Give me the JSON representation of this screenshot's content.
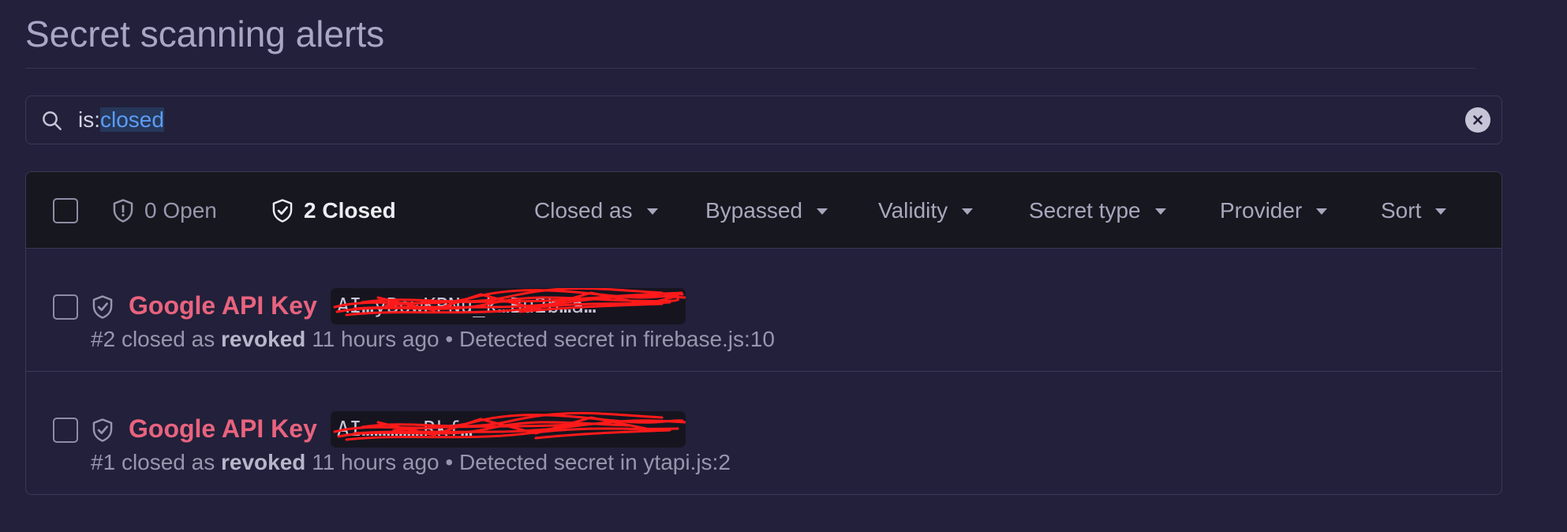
{
  "page": {
    "title": "Secret scanning alerts"
  },
  "search": {
    "prefix": "is:",
    "value": "closed",
    "clear_icon": "x-circle-fill-icon"
  },
  "header": {
    "open_count_label": "0 Open",
    "closed_count_label": "2 Closed",
    "filters": [
      {
        "label": "Closed as"
      },
      {
        "label": "Bypassed"
      },
      {
        "label": "Validity"
      },
      {
        "label": "Secret type"
      },
      {
        "label": "Provider"
      },
      {
        "label": "Sort"
      }
    ]
  },
  "alerts": [
    {
      "title": "Google API Key",
      "secret_visible": "AI…yBowKPNu_k…Bu2b…a…",
      "number": "#2",
      "closed_as_prefix": "closed as",
      "closed_reason": "revoked",
      "time": "11 hours ago",
      "separator": "•",
      "detected": "Detected secret in firebase.js:10"
    },
    {
      "title": "Google API Key",
      "secret_visible": "AI……………Rkf…",
      "number": "#1",
      "closed_as_prefix": "closed as",
      "closed_reason": "revoked",
      "time": "11 hours ago",
      "separator": "•",
      "detected": "Detected secret in ytapi.js:2"
    }
  ],
  "colors": {
    "background": "#22203a",
    "header_bg": "#17171f",
    "alert_title": "#e8637e",
    "search_highlight": "#5c9cf5",
    "redaction": "#ff1a1a"
  }
}
